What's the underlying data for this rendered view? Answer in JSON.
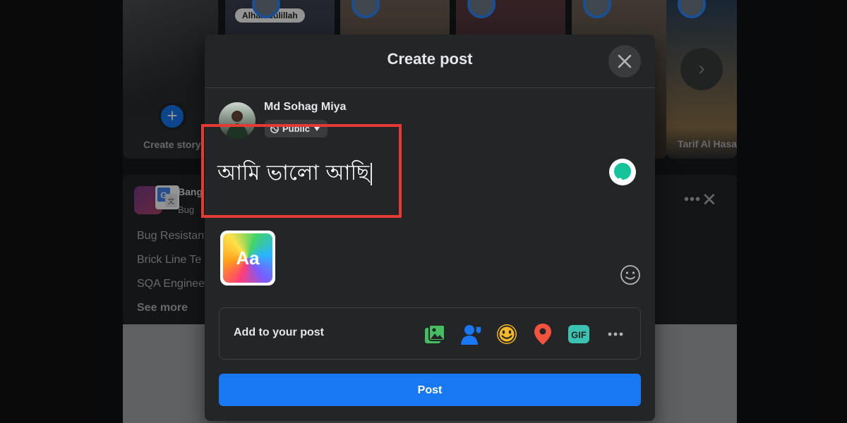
{
  "feed": {
    "create_story_label": "Create story",
    "story_tag": "Alhamdulillah",
    "story_last_label": "Tarif Al Hasan",
    "card": {
      "name": "Bang",
      "sub": "Bug",
      "lines": [
        "Bug Resistant",
        "Brick Line Te",
        "SQA Engineer",
        "See more"
      ]
    }
  },
  "modal": {
    "title": "Create post",
    "author": "Md Sohag Miya",
    "audience": "Public",
    "post_text": "আমি ভালো আছি",
    "background_button_label": "Aa",
    "add_to_post_label": "Add to your post",
    "add_icons": [
      "photo-video-icon",
      "tag-people-icon",
      "feeling-activity-icon",
      "check-in-icon",
      "gif-icon",
      "more-options-icon"
    ],
    "gif_label": "GIF",
    "post_button": "Post"
  },
  "colors": {
    "accent": "#1877f2",
    "highlight": "#e53935",
    "modal_bg": "#242526"
  }
}
